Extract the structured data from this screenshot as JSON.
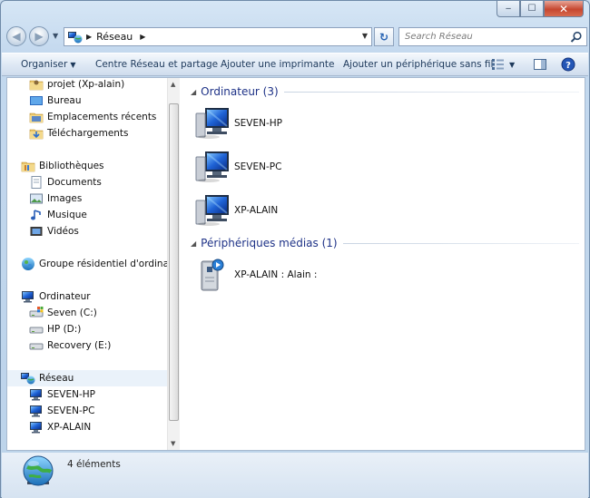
{
  "titlebar": {
    "min": "‒",
    "max": "☐",
    "close": "✕"
  },
  "address": {
    "crumbs": [
      "Réseau"
    ]
  },
  "search": {
    "placeholder": "Search Réseau"
  },
  "toolbar": {
    "organize": "Organiser",
    "network_center": "Centre Réseau et partage",
    "add_printer": "Ajouter une imprimante",
    "add_device": "Ajouter un périphérique sans fil"
  },
  "navpane": {
    "items": [
      {
        "label": "projet (Xp-alain)",
        "icon": "user-folder-icon"
      },
      {
        "label": "Bureau",
        "icon": "desktop-icon"
      },
      {
        "label": "Emplacements récents",
        "icon": "recent-places-icon"
      },
      {
        "label": "Téléchargements",
        "icon": "downloads-icon"
      },
      {
        "label": "Bibliothèques",
        "icon": "libraries-icon"
      },
      {
        "label": "Documents",
        "icon": "documents-icon"
      },
      {
        "label": "Images",
        "icon": "pictures-icon"
      },
      {
        "label": "Musique",
        "icon": "music-icon"
      },
      {
        "label": "Vidéos",
        "icon": "videos-icon"
      },
      {
        "label": "Groupe résidentiel d'ordinateurs",
        "icon": "homegroup-icon"
      },
      {
        "label": "Ordinateur",
        "icon": "computer-icon"
      },
      {
        "label": "Seven (C:)",
        "icon": "windows-drive-icon"
      },
      {
        "label": "HP (D:)",
        "icon": "drive-icon"
      },
      {
        "label": "Recovery (E:)",
        "icon": "drive-icon"
      },
      {
        "label": "Réseau",
        "icon": "network-icon"
      },
      {
        "label": "SEVEN-HP",
        "icon": "computer-icon"
      },
      {
        "label": "SEVEN-PC",
        "icon": "computer-icon"
      },
      {
        "label": "XP-ALAIN",
        "icon": "computer-icon"
      }
    ]
  },
  "content": {
    "groups": [
      {
        "title": "Ordinateur (3)",
        "items": [
          {
            "label": "SEVEN-HP",
            "icon": "network-computer-icon"
          },
          {
            "label": "SEVEN-PC",
            "icon": "network-computer-icon"
          },
          {
            "label": "XP-ALAIN",
            "icon": "network-computer-icon"
          }
        ]
      },
      {
        "title": "Périphériques médias (1)",
        "items": [
          {
            "label": "XP-ALAIN : Alain :",
            "icon": "media-server-icon"
          }
        ]
      }
    ]
  },
  "status": {
    "count": "4 éléments"
  },
  "colors": {
    "group_header": "#1e3287",
    "selection": "#eaf2fa"
  }
}
